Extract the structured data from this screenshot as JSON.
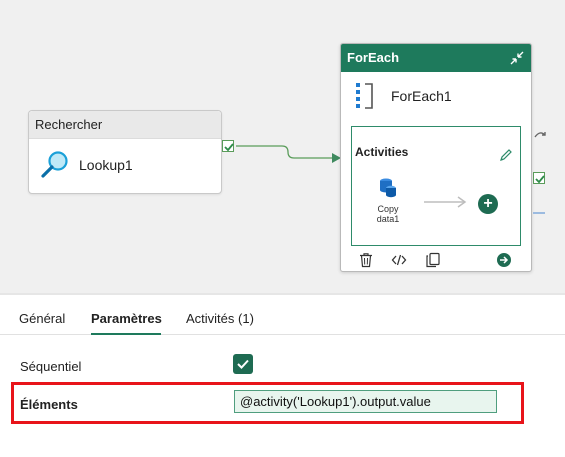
{
  "canvas": {
    "lookup": {
      "header": "Rechercher",
      "name": "Lookup1"
    },
    "foreach": {
      "header": "ForEach",
      "name": "ForEach1",
      "activities_label": "Activities",
      "copy_activity": {
        "line1": "Copy",
        "line2": "data1"
      }
    }
  },
  "tabs": [
    {
      "label": "Général",
      "active": false
    },
    {
      "label": "Paramètres",
      "active": true
    },
    {
      "label": "Activités (1)",
      "active": false
    }
  ],
  "properties": {
    "sequential": {
      "label": "Séquentiel",
      "checked": true
    },
    "items": {
      "label": "Éléments",
      "value": "@activity('Lookup1').output.value"
    }
  },
  "colors": {
    "accent": "#1e7a5c",
    "highlight": "#e8141a",
    "input_bg": "#e8f5ee"
  }
}
